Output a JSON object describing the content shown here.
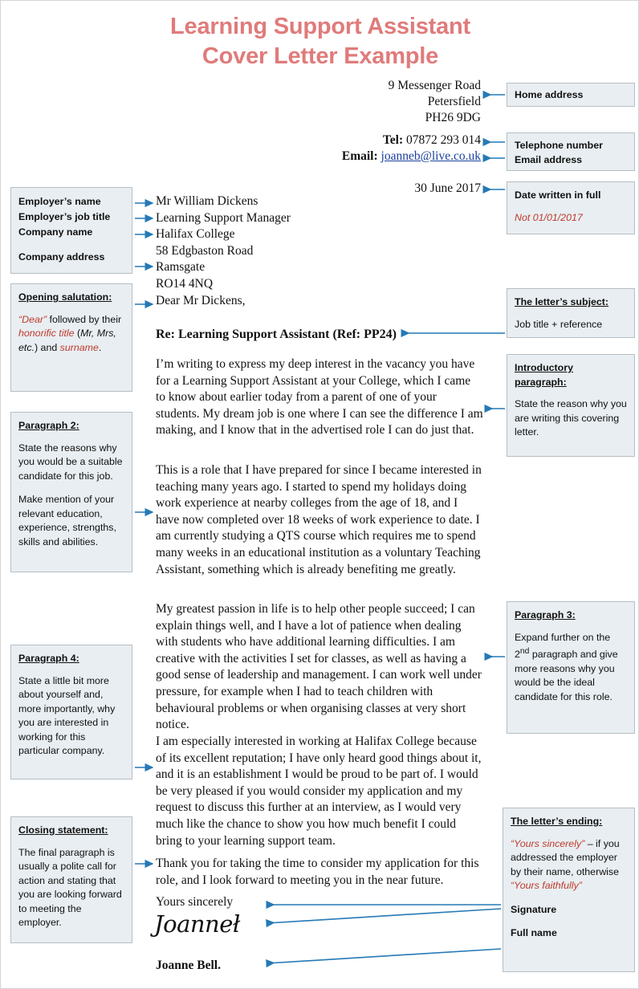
{
  "title": {
    "line1": "Learning Support Assistant",
    "line2": "Cover Letter Example",
    "color": "#e07b7b"
  },
  "letter": {
    "home_address": {
      "line1": "9 Messenger Road",
      "line2": "Petersfield",
      "line3": "PH26 9DG"
    },
    "contact": {
      "tel_label": "Tel:",
      "tel_value": "07872 293 014",
      "email_label": "Email:",
      "email_value": "joanneb@live.co.uk"
    },
    "date": "30 June 2017",
    "recipient": {
      "name": "Mr William  Dickens",
      "job_title": "Learning Support Manager",
      "company": "Halifax College",
      "address_line1": "58 Edgbaston Road",
      "address_line2": "Ramsgate",
      "address_line3": "RO14 4NQ"
    },
    "salutation": "Dear Mr Dickens,",
    "subject": "Re: Learning Support Assistant (Ref: PP24)",
    "paragraph1": "I’m writing to express my deep interest in the vacancy you have for a Learning Support Assistant at your College, which I came to know about earlier today from a parent of one of your students. My dream job is one where I can see the difference I am making, and I know that in the advertised role I can do just that.",
    "paragraph2": "This is a role that I have prepared for since I became interested in teaching many years ago. I started to spend my holidays doing work experience at nearby colleges from the age of 18, and I have now completed over 18 weeks of work experience to date. I am currently studying a QTS course which requires me to spend many weeks in an educational institution as a voluntary Teaching Assistant, something which is already benefiting me greatly.",
    "paragraph3": "My greatest passion in life is to help other people succeed; I can explain things well, and I have a lot of patience when dealing with students who have additional learning difficulties. I am creative with the activities I set for classes, as well as having a good sense of leadership and management. I can work well under pressure, for example when I had to teach children with behavioural problems or when organising classes at very short notice.",
    "paragraph4": "I am especially interested in working at Halifax College because of its excellent reputation; I have only heard good things about it, and it is an establishment I would be proud to be part of. I would be very pleased if you would consider my application and my request to discuss this further at an interview, as I would very much like the chance to show you how much benefit I could bring to your learning support team.",
    "paragraph5": "Thank you for taking the time to consider my application for this role, and I look forward to meeting you in the near future.",
    "signoff": "Yours sincerely",
    "signature": "Joanneł",
    "full_name": "Joanne Bell."
  },
  "notes": {
    "home_address": {
      "label": "Home address"
    },
    "contact": {
      "telephone_label": "Telephone number",
      "email_label": "Email address"
    },
    "date": {
      "header": "Date written in full",
      "warning": "Not 01/01/2017"
    },
    "subject": {
      "header": "The letter’s subject:",
      "body": "Job title + reference"
    },
    "intro": {
      "header_line1": "Introductory",
      "header_line2": "paragraph:",
      "body": "State the reason why you are writing this covering letter."
    },
    "employer": {
      "line1": "Employer’s name",
      "line2": "Employer’s job title",
      "line3": "Company name",
      "line4": "Company address"
    },
    "opening": {
      "header": "Opening salutation:",
      "seg1": "“Dear”",
      "seg2": " followed by their ",
      "seg3": "honorific title",
      "seg4": " (",
      "seg5": "Mr, Mrs, etc.",
      "seg6": ") and ",
      "seg7": "surname",
      "seg8": "."
    },
    "paragraph2": {
      "header": "Paragraph 2:",
      "body1": "State the reasons why you would be a suitable candidate for this job.",
      "body2": "Make mention of your relevant education, experience, strengths, skills and abilities."
    },
    "paragraph3": {
      "header": "Paragraph 3:",
      "body_part1": "Expand further on the 2",
      "body_sup": "nd",
      "body_part2": " paragraph and give more reasons why you would be the ideal candidate for this role."
    },
    "paragraph4": {
      "header": "Paragraph 4:",
      "body": "State a little bit more about yourself and, more importantly, why you are interested in working for this particular company."
    },
    "closing": {
      "header": "Closing statement:",
      "body": "The final paragraph is usually a polite call for action and stating that you are looking forward to meeting the employer."
    },
    "ending": {
      "header": "The letter’s ending:",
      "seg1": "“Yours sincerely”",
      "seg2": " – if you addressed the employer by their name, otherwise ",
      "seg3": "“Yours faithfully”",
      "signature_label": "Signature",
      "fullname_label": "Full name"
    }
  },
  "colors": {
    "accent_title": "#e07b7b",
    "note_bg": "#e8eef2",
    "note_border": "#b7bec4",
    "arrow": "#2579b5",
    "red_text": "#c0392b",
    "link": "#1b40a0"
  }
}
